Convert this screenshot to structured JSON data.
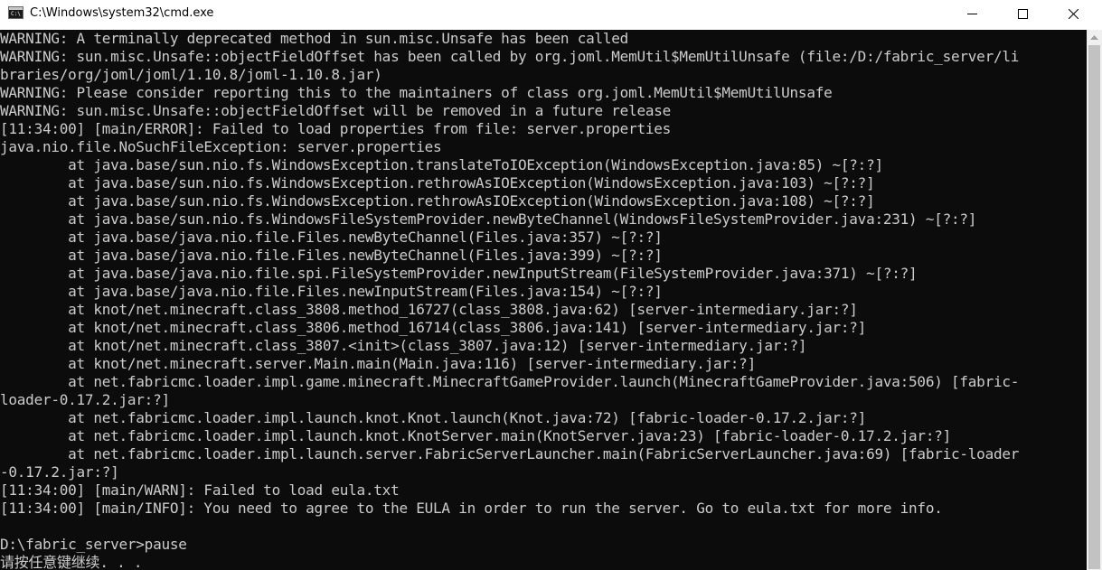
{
  "window": {
    "title": "C:\\Windows\\system32\\cmd.exe",
    "icon": "cmd-icon",
    "icon_glyph": "C:\\",
    "controls": {
      "minimize_icon": "minimize-icon",
      "maximize_icon": "maximize-icon",
      "close_icon": "close-icon"
    }
  },
  "console": {
    "background": "#0c0c0c",
    "foreground": "#cccccc",
    "lines": [
      "WARNING: A terminally deprecated method in sun.misc.Unsafe has been called",
      "WARNING: sun.misc.Unsafe::objectFieldOffset has been called by org.joml.MemUtil$MemUtilUnsafe (file:/D:/fabric_server/li",
      "braries/org/joml/joml/1.10.8/joml-1.10.8.jar)",
      "WARNING: Please consider reporting this to the maintainers of class org.joml.MemUtil$MemUtilUnsafe",
      "WARNING: sun.misc.Unsafe::objectFieldOffset will be removed in a future release",
      "[11:34:00] [main/ERROR]: Failed to load properties from file: server.properties",
      "java.nio.file.NoSuchFileException: server.properties",
      "        at java.base/sun.nio.fs.WindowsException.translateToIOException(WindowsException.java:85) ~[?:?]",
      "        at java.base/sun.nio.fs.WindowsException.rethrowAsIOException(WindowsException.java:103) ~[?:?]",
      "        at java.base/sun.nio.fs.WindowsException.rethrowAsIOException(WindowsException.java:108) ~[?:?]",
      "        at java.base/sun.nio.fs.WindowsFileSystemProvider.newByteChannel(WindowsFileSystemProvider.java:231) ~[?:?]",
      "        at java.base/java.nio.file.Files.newByteChannel(Files.java:357) ~[?:?]",
      "        at java.base/java.nio.file.Files.newByteChannel(Files.java:399) ~[?:?]",
      "        at java.base/java.nio.file.spi.FileSystemProvider.newInputStream(FileSystemProvider.java:371) ~[?:?]",
      "        at java.base/java.nio.file.Files.newInputStream(Files.java:154) ~[?:?]",
      "        at knot/net.minecraft.class_3808.method_16727(class_3808.java:62) [server-intermediary.jar:?]",
      "        at knot/net.minecraft.class_3806.method_16714(class_3806.java:141) [server-intermediary.jar:?]",
      "        at knot/net.minecraft.class_3807.<init>(class_3807.java:12) [server-intermediary.jar:?]",
      "        at knot/net.minecraft.server.Main.main(Main.java:116) [server-intermediary.jar:?]",
      "        at net.fabricmc.loader.impl.game.minecraft.MinecraftGameProvider.launch(MinecraftGameProvider.java:506) [fabric-",
      "loader-0.17.2.jar:?]",
      "        at net.fabricmc.loader.impl.launch.knot.Knot.launch(Knot.java:72) [fabric-loader-0.17.2.jar:?]",
      "        at net.fabricmc.loader.impl.launch.knot.KnotServer.main(KnotServer.java:23) [fabric-loader-0.17.2.jar:?]",
      "        at net.fabricmc.loader.impl.launch.server.FabricServerLauncher.main(FabricServerLauncher.java:69) [fabric-loader",
      "-0.17.2.jar:?]",
      "[11:34:00] [main/WARN]: Failed to load eula.txt",
      "[11:34:00] [main/INFO]: You need to agree to the EULA in order to run the server. Go to eula.txt for more info.",
      "",
      "D:\\fabric_server>pause",
      "请按任意键继续. . ."
    ]
  },
  "scrollbar": {
    "up_arrow_icon": "scroll-up-arrow-icon"
  }
}
